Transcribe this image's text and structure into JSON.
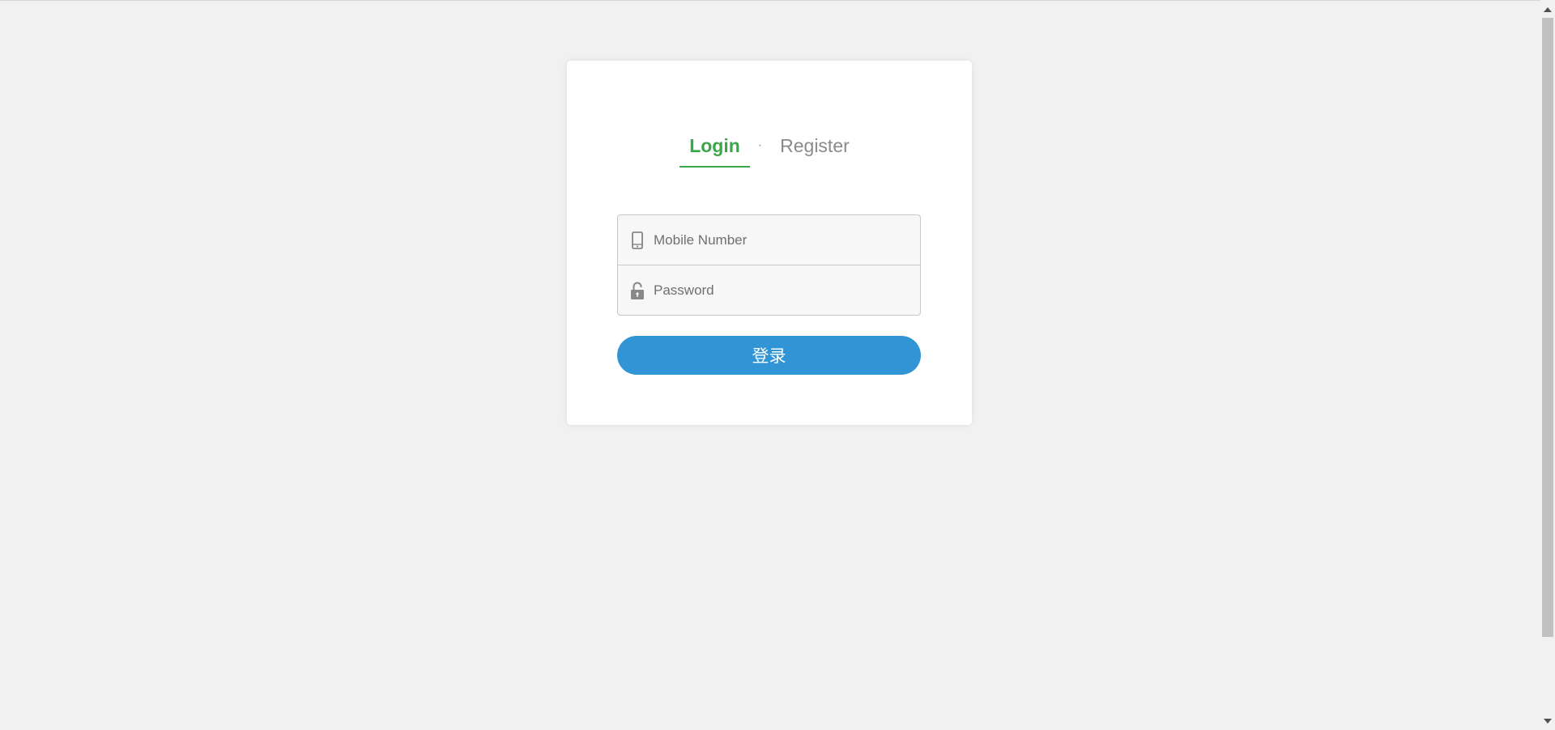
{
  "auth": {
    "tabs": {
      "login_label": "Login",
      "separator": "·",
      "register_label": "Register"
    },
    "fields": {
      "mobile": {
        "placeholder": "Mobile Number",
        "value": "",
        "icon": "mobile-phone-icon"
      },
      "password": {
        "placeholder": "Password",
        "value": "",
        "icon": "lock-icon"
      }
    },
    "submit_label": "登录"
  },
  "colors": {
    "background": "#f1f1f1",
    "active_tab": "#3aa848",
    "inactive_tab": "#8a8a8a",
    "button": "#3194d4",
    "input_background": "#f7f7f7"
  }
}
